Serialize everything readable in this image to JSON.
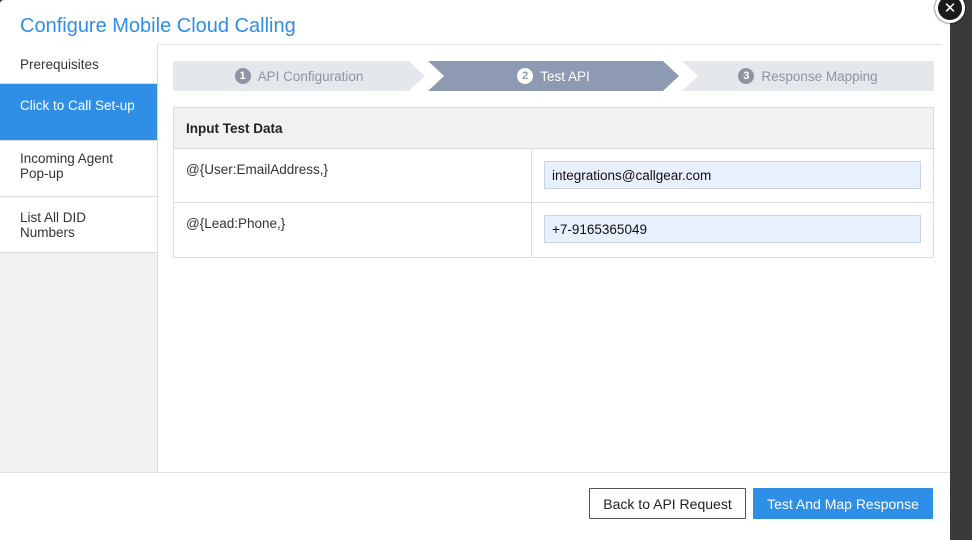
{
  "dialog": {
    "title": "Configure Mobile Cloud Calling",
    "close_icon": "close-icon"
  },
  "sidebar": {
    "items": [
      {
        "label": "Prerequisites",
        "active": false
      },
      {
        "label": "Click to Call Set-up",
        "active": true
      },
      {
        "label": "Incoming Agent Pop-up",
        "active": false
      },
      {
        "label": "List All DID Numbers",
        "active": false
      }
    ]
  },
  "steps": [
    {
      "number": "1",
      "label": "API Configuration",
      "state": "done"
    },
    {
      "number": "2",
      "label": "Test API",
      "state": "active"
    },
    {
      "number": "3",
      "label": "Response Mapping",
      "state": "pending"
    }
  ],
  "test_data": {
    "header": "Input Test Data",
    "rows": [
      {
        "label": "@{User:EmailAddress,}",
        "value": "integrations@callgear.com"
      },
      {
        "label": "@{Lead:Phone,}",
        "value": "+7-9165365049"
      }
    ]
  },
  "footer": {
    "back_label": "Back to API Request",
    "test_label": "Test And Map Response"
  },
  "colors": {
    "accent": "#2f8fe6",
    "step_active": "#8d9ab2",
    "step_inactive": "#e4e7ec"
  }
}
